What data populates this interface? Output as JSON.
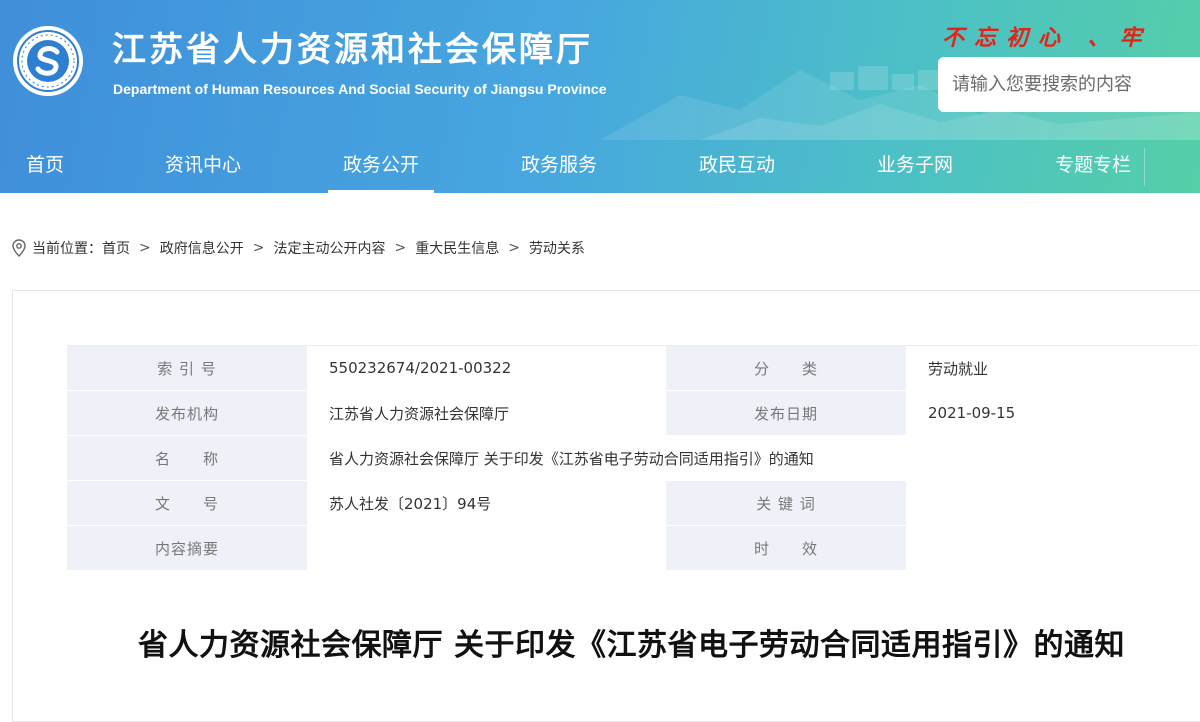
{
  "header": {
    "title": "江苏省人力资源和社会保障厅",
    "subtitle": "Department of Human Resources And Social Security of Jiangsu Province",
    "slogan": "不忘初心 、牢",
    "search_placeholder": "请输入您要搜索的内容",
    "logo_icon": "social-security-logo",
    "colors": {
      "header_start": "#3f8fd9",
      "header_end": "#55cfa8",
      "slogan": "#e2231a"
    }
  },
  "nav": {
    "items": [
      {
        "label": "首页"
      },
      {
        "label": "资讯中心"
      },
      {
        "label": "政务公开",
        "active": true
      },
      {
        "label": "政务服务"
      },
      {
        "label": "政民互动"
      },
      {
        "label": "业务子网"
      },
      {
        "label": "专题专栏"
      }
    ]
  },
  "breadcrumb": {
    "prefix": "当前位置：",
    "icon": "location-pin-icon",
    "items": [
      "首页",
      "政府信息公开",
      "法定主动公开内容",
      "重大民生信息",
      "劳动关系"
    ],
    "separator": ">"
  },
  "meta": {
    "index_label": "索 引 号",
    "index_value": "550232674/2021-00322",
    "category_label": "分　　类",
    "category_value": "劳动就业",
    "publisher_label": "发布机构",
    "publisher_value": "江苏省人力资源社会保障厅",
    "date_label": "发布日期",
    "date_value": "2021-09-15",
    "name_label": "名　　称",
    "name_value": "省人力资源社会保障厅 关于印发《江苏省电子劳动合同适用指引》的通知",
    "docno_label": "文　　号",
    "docno_value": "苏人社发〔2021〕94号",
    "keywords_label": "关 键 词",
    "keywords_value": "",
    "summary_label": "内容摘要",
    "summary_value": "",
    "validity_label": "时　　效",
    "validity_value": ""
  },
  "document": {
    "title": "省人力资源社会保障厅 关于印发《江苏省电子劳动合同适用指引》的通知"
  }
}
